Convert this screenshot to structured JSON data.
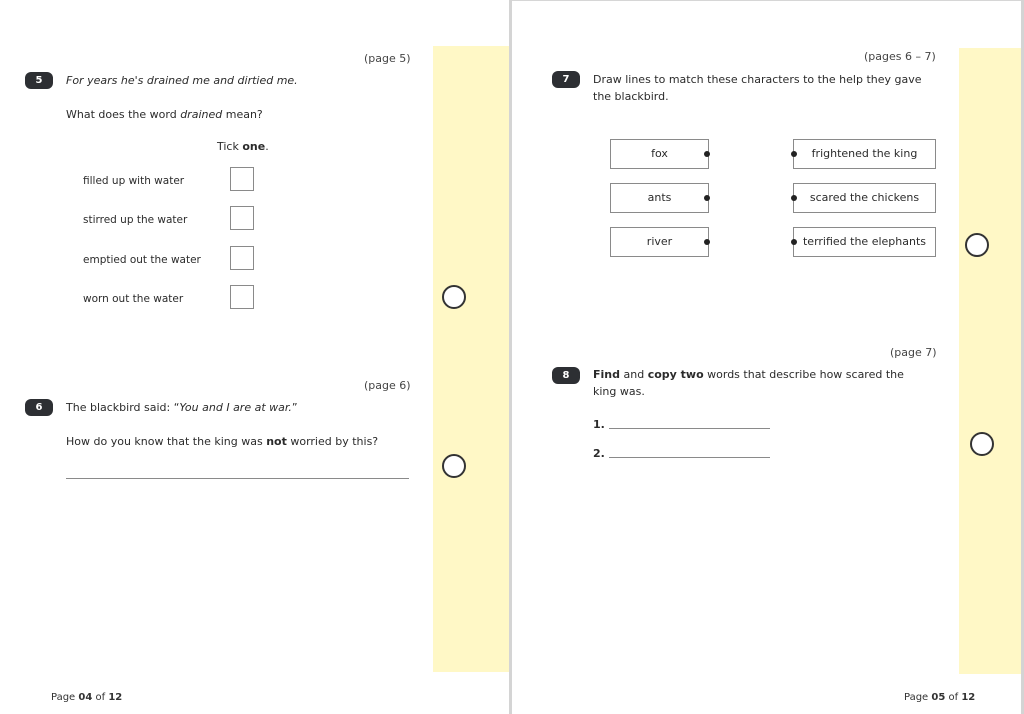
{
  "left_page": {
    "footer": {
      "prefix": "Page ",
      "current": "04",
      "middle": " of ",
      "total": "12"
    },
    "q5": {
      "number": "5",
      "page_ref": "(page 5)",
      "quote": "For years he's drained me and dirtied me.",
      "question_prefix": "What does the word ",
      "question_emph": "drained",
      "question_suffix": " mean?",
      "instruction_prefix": "Tick ",
      "instruction_emph": "one",
      "instruction_suffix": ".",
      "options": [
        {
          "label": "filled up with water",
          "checked": false
        },
        {
          "label": "stirred up the water",
          "checked": false
        },
        {
          "label": "emptied out the water",
          "checked": false
        },
        {
          "label": "worn out the water",
          "checked": false
        }
      ]
    },
    "q6": {
      "number": "6",
      "page_ref": "(page 6)",
      "statement_prefix": "The blackbird said: “",
      "statement_quote": "You and I are at war.",
      "statement_suffix": "”",
      "question_prefix": "How do you know that the king was ",
      "question_emph": "not",
      "question_suffix": " worried by this?",
      "answer": ""
    }
  },
  "right_page": {
    "footer": {
      "prefix": "Page ",
      "current": "05",
      "middle": " of ",
      "total": "12"
    },
    "q7": {
      "number": "7",
      "page_ref": "(pages 6 – 7)",
      "prompt_line1": "Draw lines to match these characters to the help they gave",
      "prompt_line2": "the blackbird.",
      "characters": [
        "fox",
        "ants",
        "river"
      ],
      "help": [
        "frightened the king",
        "scared the chickens",
        "terrified the elephants"
      ]
    },
    "q8": {
      "number": "8",
      "page_ref": "(page 7)",
      "w1": "Find",
      "w2": " and ",
      "w3": "copy two",
      "w4": " words that describe how scared the",
      "line2": "king was.",
      "answers": [
        {
          "label": "1.",
          "value": ""
        },
        {
          "label": "2.",
          "value": ""
        }
      ]
    }
  },
  "colors": {
    "margin_strip": "#fff8c6",
    "question_badge": "#2d2f33"
  }
}
